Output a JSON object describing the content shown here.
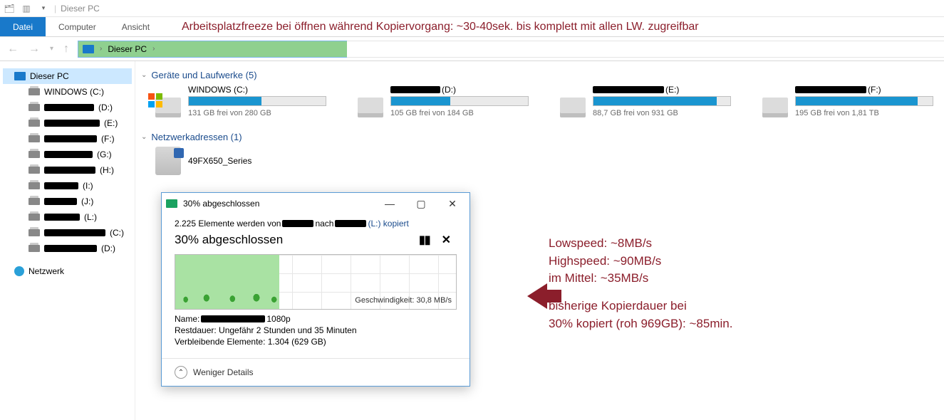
{
  "titlebar": {
    "title": "Dieser PC"
  },
  "ribbon": {
    "file": "Datei",
    "computer": "Computer",
    "view": "Ansicht"
  },
  "annotation_top": "Arbeitsplatzfreeze bei öffnen während Kopiervorgang:   ~30-40sek. bis komplett mit allen LW. zugreifbar",
  "address": {
    "root": "Dieser PC"
  },
  "sidebar": {
    "root": "Dieser PC",
    "items": [
      {
        "label": "WINDOWS (C:)",
        "letter": "(C:)"
      },
      {
        "letter": "(D:)"
      },
      {
        "letter": "(E:)"
      },
      {
        "letter": "(F:)"
      },
      {
        "letter": "(G:)"
      },
      {
        "letter": "(H:)"
      },
      {
        "letter": "(I:)"
      },
      {
        "letter": "(J:)"
      },
      {
        "letter": "(L:)"
      },
      {
        "letter": "(C:)"
      },
      {
        "letter": "(D:)"
      }
    ],
    "network": "Netzwerk"
  },
  "groups": {
    "drives_hdr": "Geräte und Laufwerke (5)",
    "net_hdr": "Netzwerkadressen (1)"
  },
  "drives": [
    {
      "label": "WINDOWS (C:)",
      "free": "131 GB frei von 280 GB",
      "fill": 53,
      "win": true
    },
    {
      "letter": "(D:)",
      "free": "105 GB frei von 184 GB",
      "fill": 43
    },
    {
      "letter": "(E:)",
      "free": "88,7 GB frei von 931 GB",
      "fill": 90
    },
    {
      "letter": "(F:)",
      "free": "195 GB frei von 1,81 TB",
      "fill": 89
    }
  ],
  "netloc": {
    "label": "49FX650_Series"
  },
  "dialog": {
    "title": "30% abgeschlossen",
    "line1_a": "2.225 Elemente werden von",
    "line1_b": "nach",
    "line1_c": "(L:) kopiert",
    "heading": "30% abgeschlossen",
    "speed_label": "Geschwindigkeit: 30,8 MB/s",
    "name_label": "Name:",
    "name_suffix": "1080p",
    "remaining_time": "Restdauer:  Ungefähr 2 Stunden und 35 Minuten",
    "remaining_items": "Verbleibende Elemente:  1.304 (629 GB)",
    "fewer_details": "Weniger Details"
  },
  "annot": {
    "l1": "Lowspeed:   ~8MB/s",
    "l2": "Highspeed:  ~90MB/s",
    "l3": "im Mittel:      ~35MB/s",
    "l4": "bisherige Kopierdauer bei",
    "l5": "30% kopiert (roh 969GB):   ~85min."
  }
}
